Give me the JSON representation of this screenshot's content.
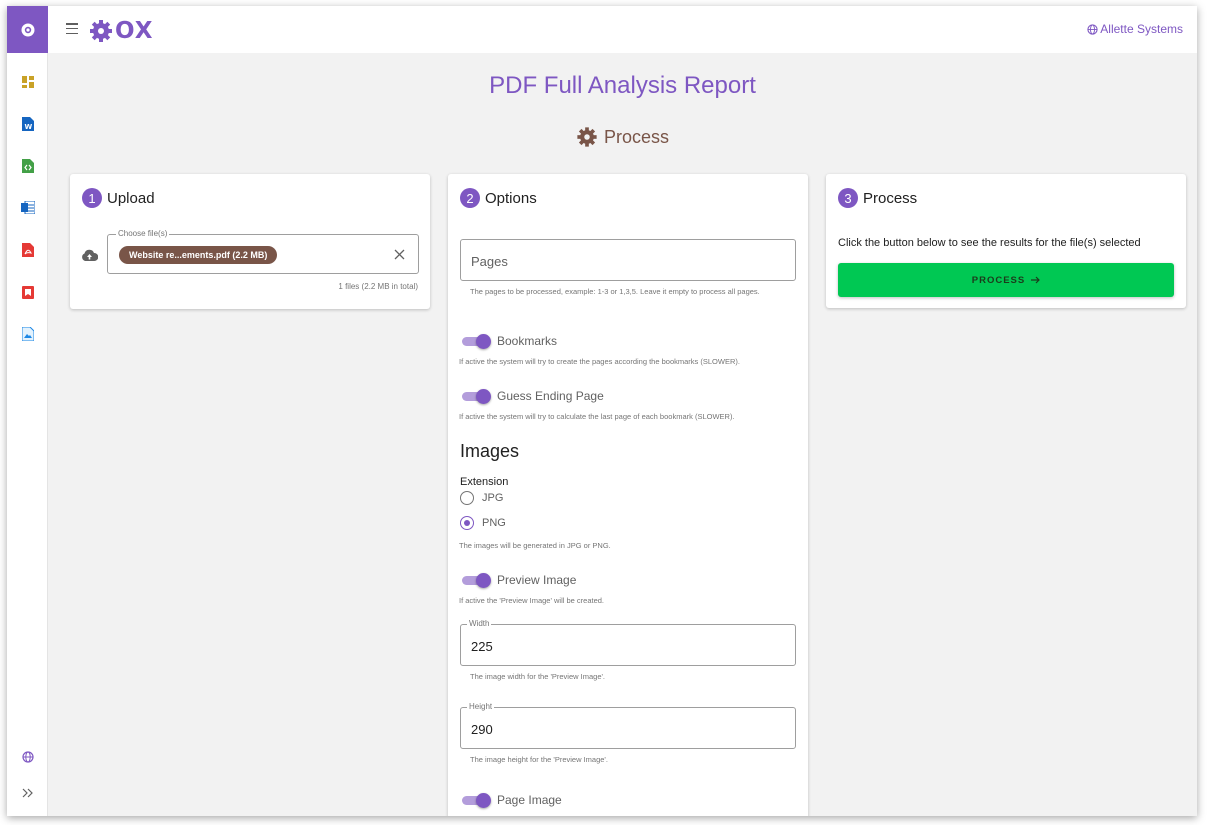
{
  "brand": {
    "logo_text": "OX",
    "company": "Allette Systems"
  },
  "page": {
    "title": "PDF Full Analysis Report",
    "subtitle": "Process"
  },
  "upload": {
    "step": "1",
    "heading": "Upload",
    "field_label": "Choose file(s)",
    "file_chip": "Website re...ements.pdf (2.2 MB)",
    "count_hint": "1 files (2.2 MB in total)"
  },
  "options": {
    "step": "2",
    "heading": "Options",
    "pages": {
      "placeholder": "Pages",
      "hint": "The pages to be processed, example: 1-3 or 1,3,5. Leave it empty to process all pages."
    },
    "bookmarks": {
      "label": "Bookmarks",
      "on": true,
      "desc": "If active the system will try to create the pages according the bookmarks (SLOWER)."
    },
    "guess_ending": {
      "label": "Guess Ending Page",
      "on": true,
      "desc": "If active the system will try to calculate the last page of each bookmark (SLOWER)."
    },
    "images_title": "Images",
    "extension": {
      "label": "Extension",
      "options": [
        "JPG",
        "PNG"
      ],
      "selected": "PNG",
      "desc": "The images will be generated in JPG or PNG."
    },
    "preview_image": {
      "label": "Preview Image",
      "on": true,
      "desc": "If active the 'Preview Image' will be created."
    },
    "width": {
      "label": "Width",
      "value": "225",
      "hint": "The image width for the 'Preview Image'."
    },
    "height": {
      "label": "Height",
      "value": "290",
      "hint": "The image height for the 'Preview Image'."
    },
    "page_image": {
      "label": "Page Image",
      "on": true
    }
  },
  "process": {
    "step": "3",
    "heading": "Process",
    "text": "Click the button below to see the results for the file(s) selected",
    "button": "PROCESS",
    "button_color": "#00c853"
  },
  "sidebar": {
    "items": [
      {
        "icon": "dashboard-icon"
      },
      {
        "icon": "word-doc-icon"
      },
      {
        "icon": "code-file-icon"
      },
      {
        "icon": "word-table-icon"
      },
      {
        "icon": "pdf-file-icon"
      },
      {
        "icon": "bookmark-icon"
      },
      {
        "icon": "image-file-icon"
      }
    ],
    "bottom": [
      {
        "icon": "globe-icon"
      },
      {
        "icon": "expand-icon"
      }
    ]
  },
  "colors": {
    "accent": "#7e57c2",
    "brown": "#795548",
    "green": "#00c853"
  }
}
